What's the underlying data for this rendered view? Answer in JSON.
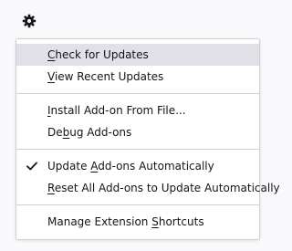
{
  "toolbar": {
    "icon": "gear-icon"
  },
  "menu": {
    "items": [
      {
        "key": "C",
        "rest": "heck for Updates",
        "pre": "",
        "highlighted": true
      },
      {
        "key": "V",
        "rest": "iew Recent Updates",
        "pre": ""
      },
      {
        "key": "I",
        "rest": "nstall Add-on From File...",
        "pre": ""
      },
      {
        "pre": "De",
        "key": "b",
        "rest": "ug Add-ons"
      },
      {
        "pre": "Update ",
        "key": "A",
        "rest": "dd-ons Automatically",
        "checked": true,
        "check_icon": "checkmark-icon"
      },
      {
        "key": "R",
        "rest": "eset All Add-ons to Update Automatically",
        "pre": ""
      },
      {
        "pre": "Manage Extension ",
        "key": "S",
        "rest": "hortcuts"
      }
    ]
  },
  "colors": {
    "highlight": "#e0e0e6",
    "border": "#cfcfd8",
    "text": "#15141a"
  }
}
